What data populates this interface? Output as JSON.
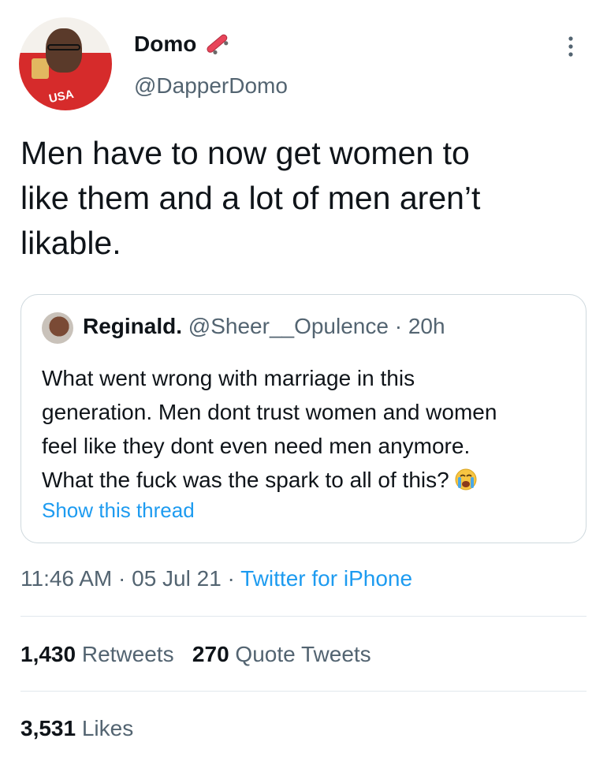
{
  "author": {
    "display_name": "Domo",
    "handle": "@DapperDomo",
    "avatar_shirt_text": "USA"
  },
  "tweet": {
    "text_line1": "Men have to now get women to",
    "text_line2": "like them and a lot of men aren’t",
    "text_line3": "likable."
  },
  "quote": {
    "display_name": "Reginald.",
    "handle": "@Sheer__Opulence",
    "separator": "·",
    "time": "20h",
    "line1": "What went wrong with marriage in this",
    "line2": "generation. Men dont trust women and women",
    "line3": "feel like they dont even need men anymore.",
    "line4": "What the fuck was the spark to all of this?",
    "emoji": "loudly-crying-face-icon",
    "show_thread": "Show this thread"
  },
  "meta": {
    "time": "11:46 AM",
    "sep1": "·",
    "date": "05 Jul 21",
    "sep2": "·",
    "source": "Twitter for iPhone"
  },
  "stats": {
    "retweets_count": "1,430",
    "retweets_label": "Retweets",
    "quotes_count": "270",
    "quotes_label": "Quote Tweets",
    "likes_count": "3,531",
    "likes_label": "Likes"
  },
  "colors": {
    "link_blue": "#1d9bf0",
    "secondary_text": "#536471",
    "divider": "#e1e8ed"
  },
  "icons": {
    "name_icon": "skateboard-icon",
    "more": "more-vertical-icon"
  }
}
